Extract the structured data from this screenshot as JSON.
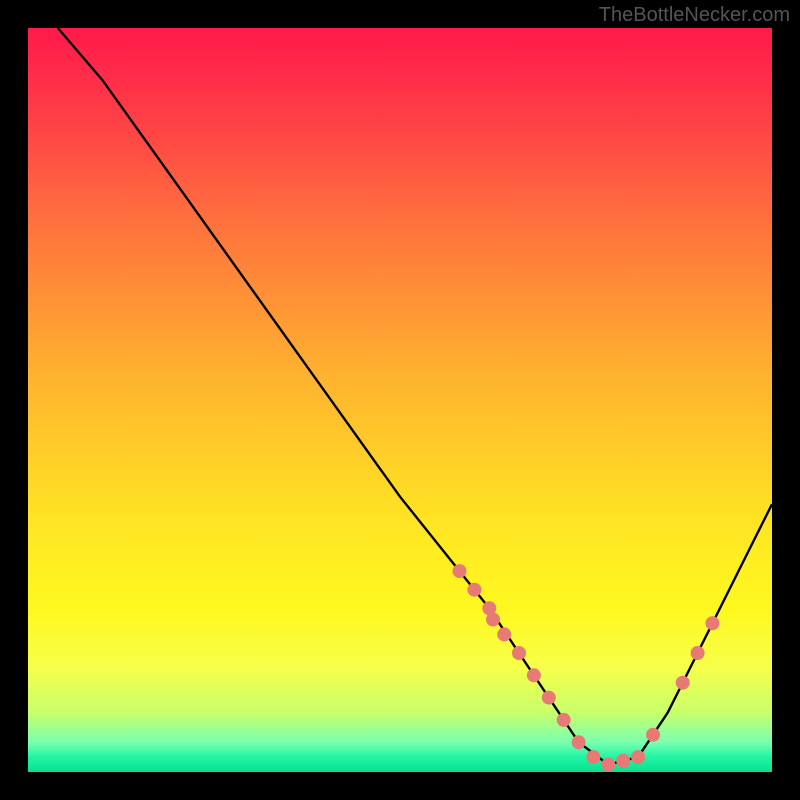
{
  "watermark": "TheBottleNecker.com",
  "chart_data": {
    "type": "line",
    "title": "",
    "xlabel": "",
    "ylabel": "",
    "xlim": [
      0,
      100
    ],
    "ylim": [
      0,
      100
    ],
    "note": "Bottleneck-style curve over red-yellow-green vertical gradient. y is mismatch/penalty (0 at green bottom, 100 at red top). Curve reaches minimum near x≈77 then rises. Salmon dots mark sampled points along the curve.",
    "series": [
      {
        "name": "curve",
        "x": [
          4,
          10,
          20,
          30,
          40,
          50,
          58,
          62,
          66,
          70,
          74,
          78,
          82,
          86,
          90,
          94,
          98,
          100
        ],
        "y": [
          100,
          93,
          79,
          65,
          51,
          37,
          27,
          22,
          16,
          10,
          4,
          1,
          2,
          8,
          16,
          24,
          32,
          36
        ]
      }
    ],
    "dot_points": {
      "x": [
        58,
        60,
        62,
        62.5,
        64,
        66,
        68,
        70,
        72,
        74,
        76,
        78,
        80,
        82,
        84,
        88,
        90,
        92
      ],
      "y": [
        27,
        24.5,
        22,
        20.5,
        18.5,
        16,
        13,
        10,
        7,
        4,
        2,
        1,
        1.5,
        2,
        5,
        12,
        16,
        20
      ]
    },
    "gradient_stops": [
      {
        "pos": 0,
        "color": "#ff1a4a"
      },
      {
        "pos": 50,
        "color": "#ffd028"
      },
      {
        "pos": 95,
        "color": "#c8ff6a"
      },
      {
        "pos": 100,
        "color": "#08e090"
      }
    ]
  }
}
